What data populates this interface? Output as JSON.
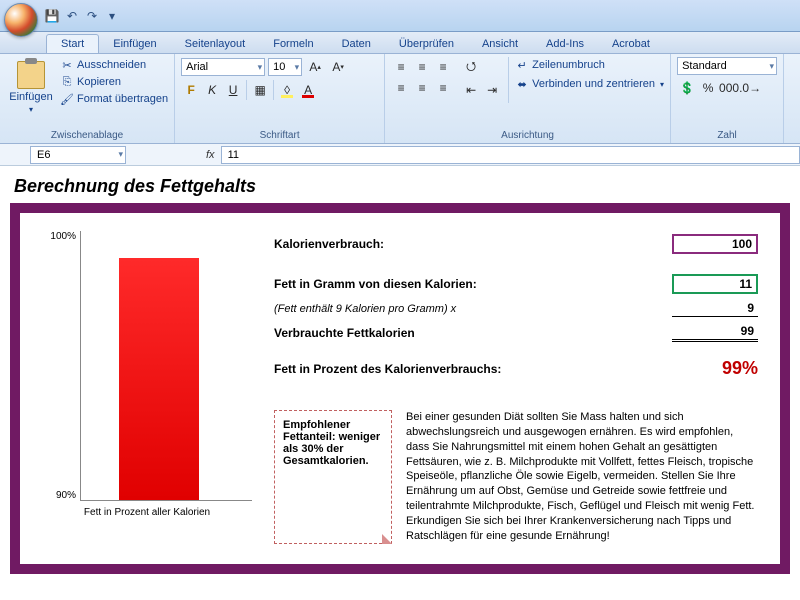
{
  "qat": {
    "save": "💾",
    "undo": "↶",
    "redo": "↷"
  },
  "tabs": [
    "Start",
    "Einfügen",
    "Seitenlayout",
    "Formeln",
    "Daten",
    "Überprüfen",
    "Ansicht",
    "Add-Ins",
    "Acrobat"
  ],
  "active_tab": "Start",
  "ribbon": {
    "clipboard": {
      "paste": "Einfügen",
      "cut": "Ausschneiden",
      "copy": "Kopieren",
      "format": "Format übertragen",
      "label": "Zwischenablage"
    },
    "font": {
      "family": "Arial",
      "size": "10",
      "bold": "F",
      "italic": "K",
      "underline": "U",
      "label": "Schriftart"
    },
    "align": {
      "wrap": "Zeilenumbruch",
      "merge": "Verbinden und zentrieren",
      "label": "Ausrichtung"
    },
    "number": {
      "format": "Standard",
      "label": "Zahl"
    }
  },
  "formula_bar": {
    "cell": "E6",
    "value": "11"
  },
  "doc": {
    "title": "Berechnung des Fettgehalts",
    "rows": {
      "cal_label": "Kalorienverbrauch:",
      "cal_value": "100",
      "fatg_label": "Fett in Gramm von diesen Kalorien:",
      "fatg_value": "11",
      "note": "(Fett enthält 9 Kalorien pro Gramm) x",
      "factor": "9",
      "fatcal_label": "Verbrauchte Fettkalorien",
      "fatcal_value": "99",
      "pct_label": "Fett in Prozent des Kalorienverbrauchs:",
      "pct_value": "99%"
    },
    "advice_box": "Empfohlener Fettanteil: weniger als 30% der Gesamtkalorien.",
    "body": "Bei einer gesunden Diät sollten Sie Mass halten und sich abwechslungsreich und ausgewogen ernähren. Es wird empfohlen, dass Sie Nahrungsmittel mit einem hohen Gehalt an gesättigten Fettsäuren, wie z. B. Milchprodukte mit Vollfett, fettes Fleisch, tropische Speiseöle, pflanzliche Öle sowie Eigelb, vermeiden. Stellen Sie Ihre Ernährung um auf Obst, Gemüse und Getreide sowie fettfreie und teilentrahmte Milchprodukte, Fisch, Geflügel und Fleisch mit wenig Fett. Erkundigen Sie sich bei Ihrer Krankenversicherung nach Tipps und Ratschlägen für eine gesunde Ernährung!"
  },
  "chart_data": {
    "type": "bar",
    "categories": [
      "Fett in Prozent aller Kalorien"
    ],
    "values": [
      99
    ],
    "title": "",
    "xlabel": "Fett in Prozent aller Kalorien",
    "ylabel": "",
    "ylim": [
      90,
      100
    ],
    "ytick_top": "100%",
    "ytick_bottom": "90%"
  }
}
